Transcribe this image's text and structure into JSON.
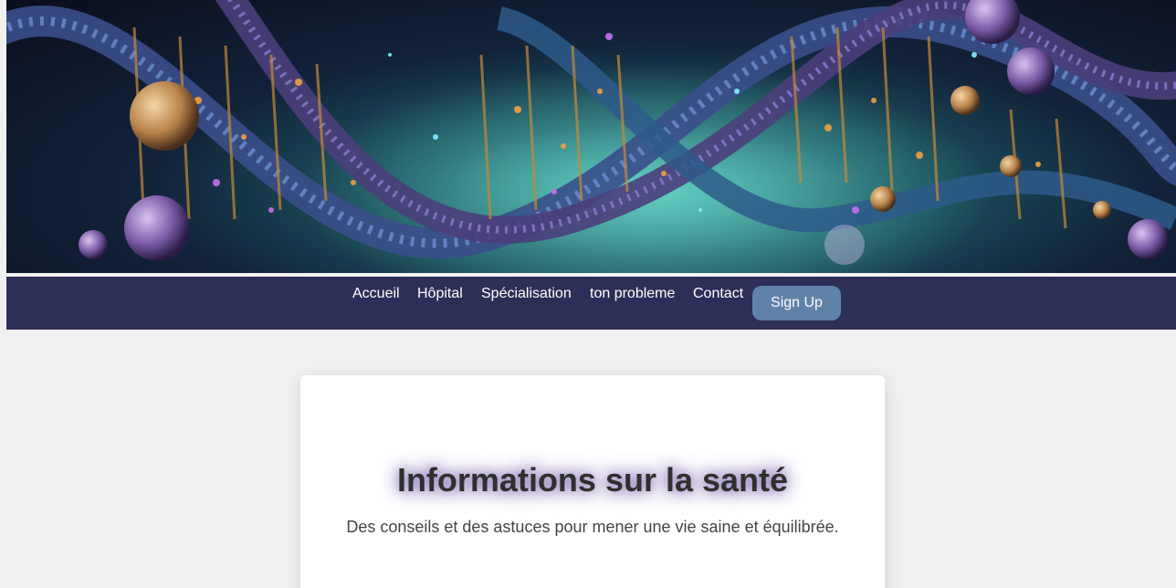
{
  "banner": {
    "image": "dna-double-helix-illustration",
    "colors": [
      "#0a0d1c",
      "#1d5a63",
      "#3fa9a0",
      "#c58a3a",
      "#8a4fc2"
    ]
  },
  "nav": {
    "links": [
      "Accueil",
      "Hôpital",
      "Spécialisation",
      "ton probleme",
      "Contact"
    ],
    "signup_label": "Sign Up",
    "background": "#2e2f58",
    "button_color": "#5f82a8"
  },
  "card": {
    "title": "Informations sur la santé",
    "subtitle": "Des conseils et des astuces pour mener une vie saine et équilibrée."
  }
}
